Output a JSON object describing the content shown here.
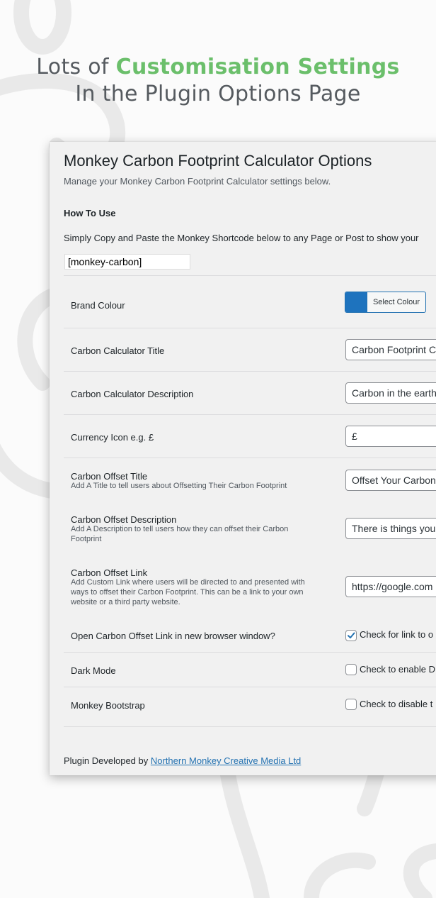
{
  "hero": {
    "line1_prefix": "Lots of ",
    "line1_accent": "Customisation Settings",
    "line2": "In the Plugin Options Page"
  },
  "colors": {
    "accent": "#6bbf6b",
    "brand": "#1e73be",
    "link": "#2271b1"
  },
  "panel": {
    "title": "Monkey Carbon Footprint Calculator Options",
    "subtitle": "Manage your Monkey Carbon Footprint Calculator settings below.",
    "how_to_use": "How To Use",
    "instructions": "Simply Copy and Paste the Monkey Shortcode below to any Page or Post to show your",
    "shortcode": "[monkey-carbon]"
  },
  "settings": {
    "brand_colour": {
      "label": "Brand Colour",
      "button": "Select Colour",
      "value": "#1e73be"
    },
    "calc_title": {
      "label": "Carbon Calculator Title",
      "value": "Carbon Footprint C"
    },
    "calc_desc": {
      "label": "Carbon Calculator Description",
      "value": "Carbon in the earth"
    },
    "currency": {
      "label": "Currency Icon e.g. £",
      "value": "£"
    },
    "offset_title": {
      "label": "Carbon Offset Title",
      "desc": "Add A Title to tell users about Offsetting Their Carbon Footprint",
      "value": "Offset Your Carbon"
    },
    "offset_desc": {
      "label": "Carbon Offset Description",
      "desc": "Add A Description to tell users how they can offset their Carbon Footprint",
      "value": "There is things you"
    },
    "offset_link": {
      "label": "Carbon Offset Link",
      "desc": "Add Custom Link where users will be directed to and presented with ways to offset their Carbon Footprint. This can be a link to your own website or a third party website.",
      "value": "https://google.com"
    },
    "new_window": {
      "label": "Open Carbon Offset Link in new browser window?",
      "checkbox_label": "Check for link to o",
      "checked": true
    },
    "dark_mode": {
      "label": "Dark Mode",
      "checkbox_label": "Check to enable D",
      "checked": false
    },
    "bootstrap": {
      "label": "Monkey Bootstrap",
      "checkbox_label": "Check to disable t",
      "checked": false
    }
  },
  "footer": {
    "prefix": "Plugin Developed by ",
    "link_text": "Northern Monkey Creative Media Ltd"
  }
}
